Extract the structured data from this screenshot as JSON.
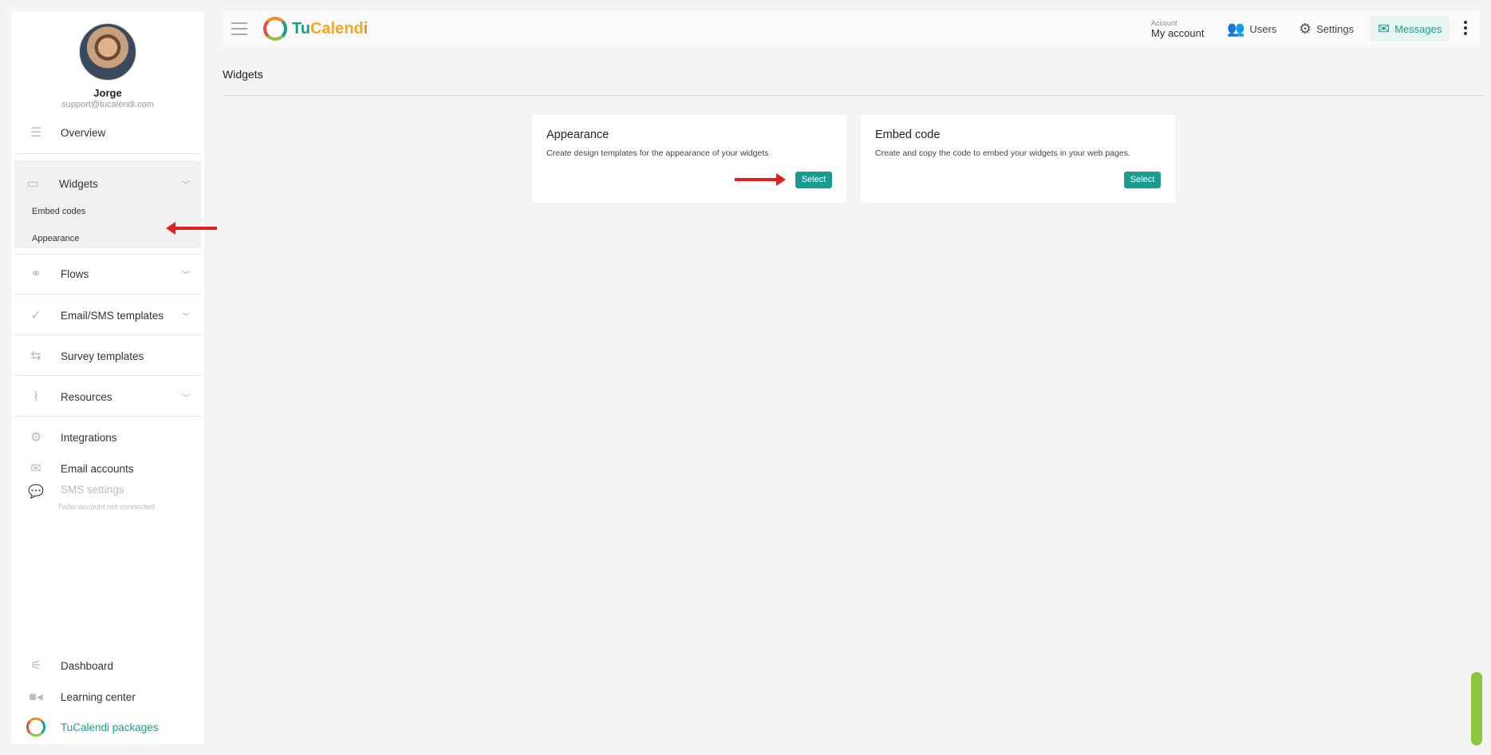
{
  "profile": {
    "name": "Jorge",
    "email": "support@tucalendi.com"
  },
  "sidebar": {
    "items": [
      {
        "label": "Overview",
        "icon": "checklist-icon"
      },
      {
        "label": "Widgets",
        "icon": "window-icon"
      },
      {
        "label": "Flows",
        "icon": "flow-icon"
      },
      {
        "label": "Email/SMS templates",
        "icon": "double-check-icon"
      },
      {
        "label": "Survey templates",
        "icon": "route-icon"
      },
      {
        "label": "Resources",
        "icon": "paperclip-icon"
      },
      {
        "label": "Integrations",
        "icon": "gears-icon"
      },
      {
        "label": "Email accounts",
        "icon": "envelope-icon"
      },
      {
        "label": "SMS settings",
        "icon": "chat-icon",
        "sub": "Twilio account not connected"
      },
      {
        "label": "Dashboard",
        "icon": "sliders-icon"
      },
      {
        "label": "Learning center",
        "icon": "video-icon"
      },
      {
        "label": "TuCalendi packages",
        "icon": "tucalendi-logo-icon"
      }
    ],
    "widgets_sub": [
      "Embed codes",
      "Appearance"
    ]
  },
  "header": {
    "logo": {
      "tu": "Tu",
      "calend": "Calend",
      "i": "i"
    },
    "account_small": "Account",
    "account_main": "My account",
    "users": "Users",
    "settings": "Settings",
    "messages": "Messages"
  },
  "main": {
    "title": "Widgets",
    "cards": [
      {
        "title": "Appearance",
        "desc": "Create design templates for the appearance of your widgets",
        "button": "Select"
      },
      {
        "title": "Embed code",
        "desc": "Create and copy the code to embed your widgets in your web pages.",
        "button": "Select"
      }
    ]
  },
  "colors": {
    "accent": "#1a9c8e",
    "annotation": "#e21f1f",
    "scrollbar": "#8cc63f"
  }
}
